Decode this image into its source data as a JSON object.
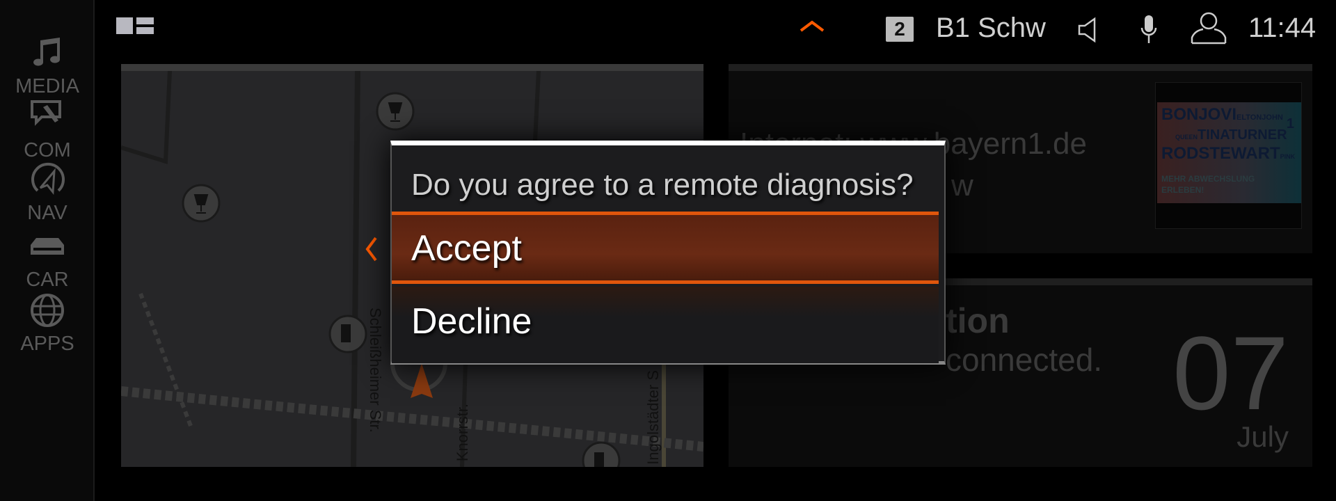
{
  "sidebar": {
    "items": [
      {
        "label": "MEDIA",
        "icon": "music-note-icon"
      },
      {
        "label": "COM",
        "icon": "phone-message-icon"
      },
      {
        "label": "NAV",
        "icon": "navigation-icon"
      },
      {
        "label": "CAR",
        "icon": "car-icon"
      },
      {
        "label": "APPS",
        "icon": "globe-icon"
      }
    ]
  },
  "topbar": {
    "layout_icon": "split-layout-icon",
    "chevron_icon": "chevron-up-icon",
    "station_number": "2",
    "station_name": "B1 Schw",
    "time": "11:44",
    "accent": "#ff5a00"
  },
  "map": {
    "streets": [
      "Schleißheimer Str.",
      "Knorrstr.",
      "Ingolstädter S"
    ]
  },
  "radio_panel": {
    "line1": "Internet: www.bayern1.de",
    "line2": "w",
    "album_art": {
      "line1": "BONJOVI",
      "line1b": "ELTONJOHN",
      "line2a": "QUEEN",
      "line2": "TINATURNER",
      "line3": "RODSTEWART",
      "line3b": "PINK",
      "badge": "1",
      "tagline1": "MEHR ABWECHSLUNG",
      "tagline2": "ERLEBEN!"
    }
  },
  "phone_panel": {
    "title_fragment": "tion",
    "status_fragment": "connected.",
    "day": "07",
    "month": "July"
  },
  "dialog": {
    "question": "Do you agree to a remote diagnosis?",
    "accept": "Accept",
    "decline": "Decline",
    "accent": "#e0560c"
  }
}
